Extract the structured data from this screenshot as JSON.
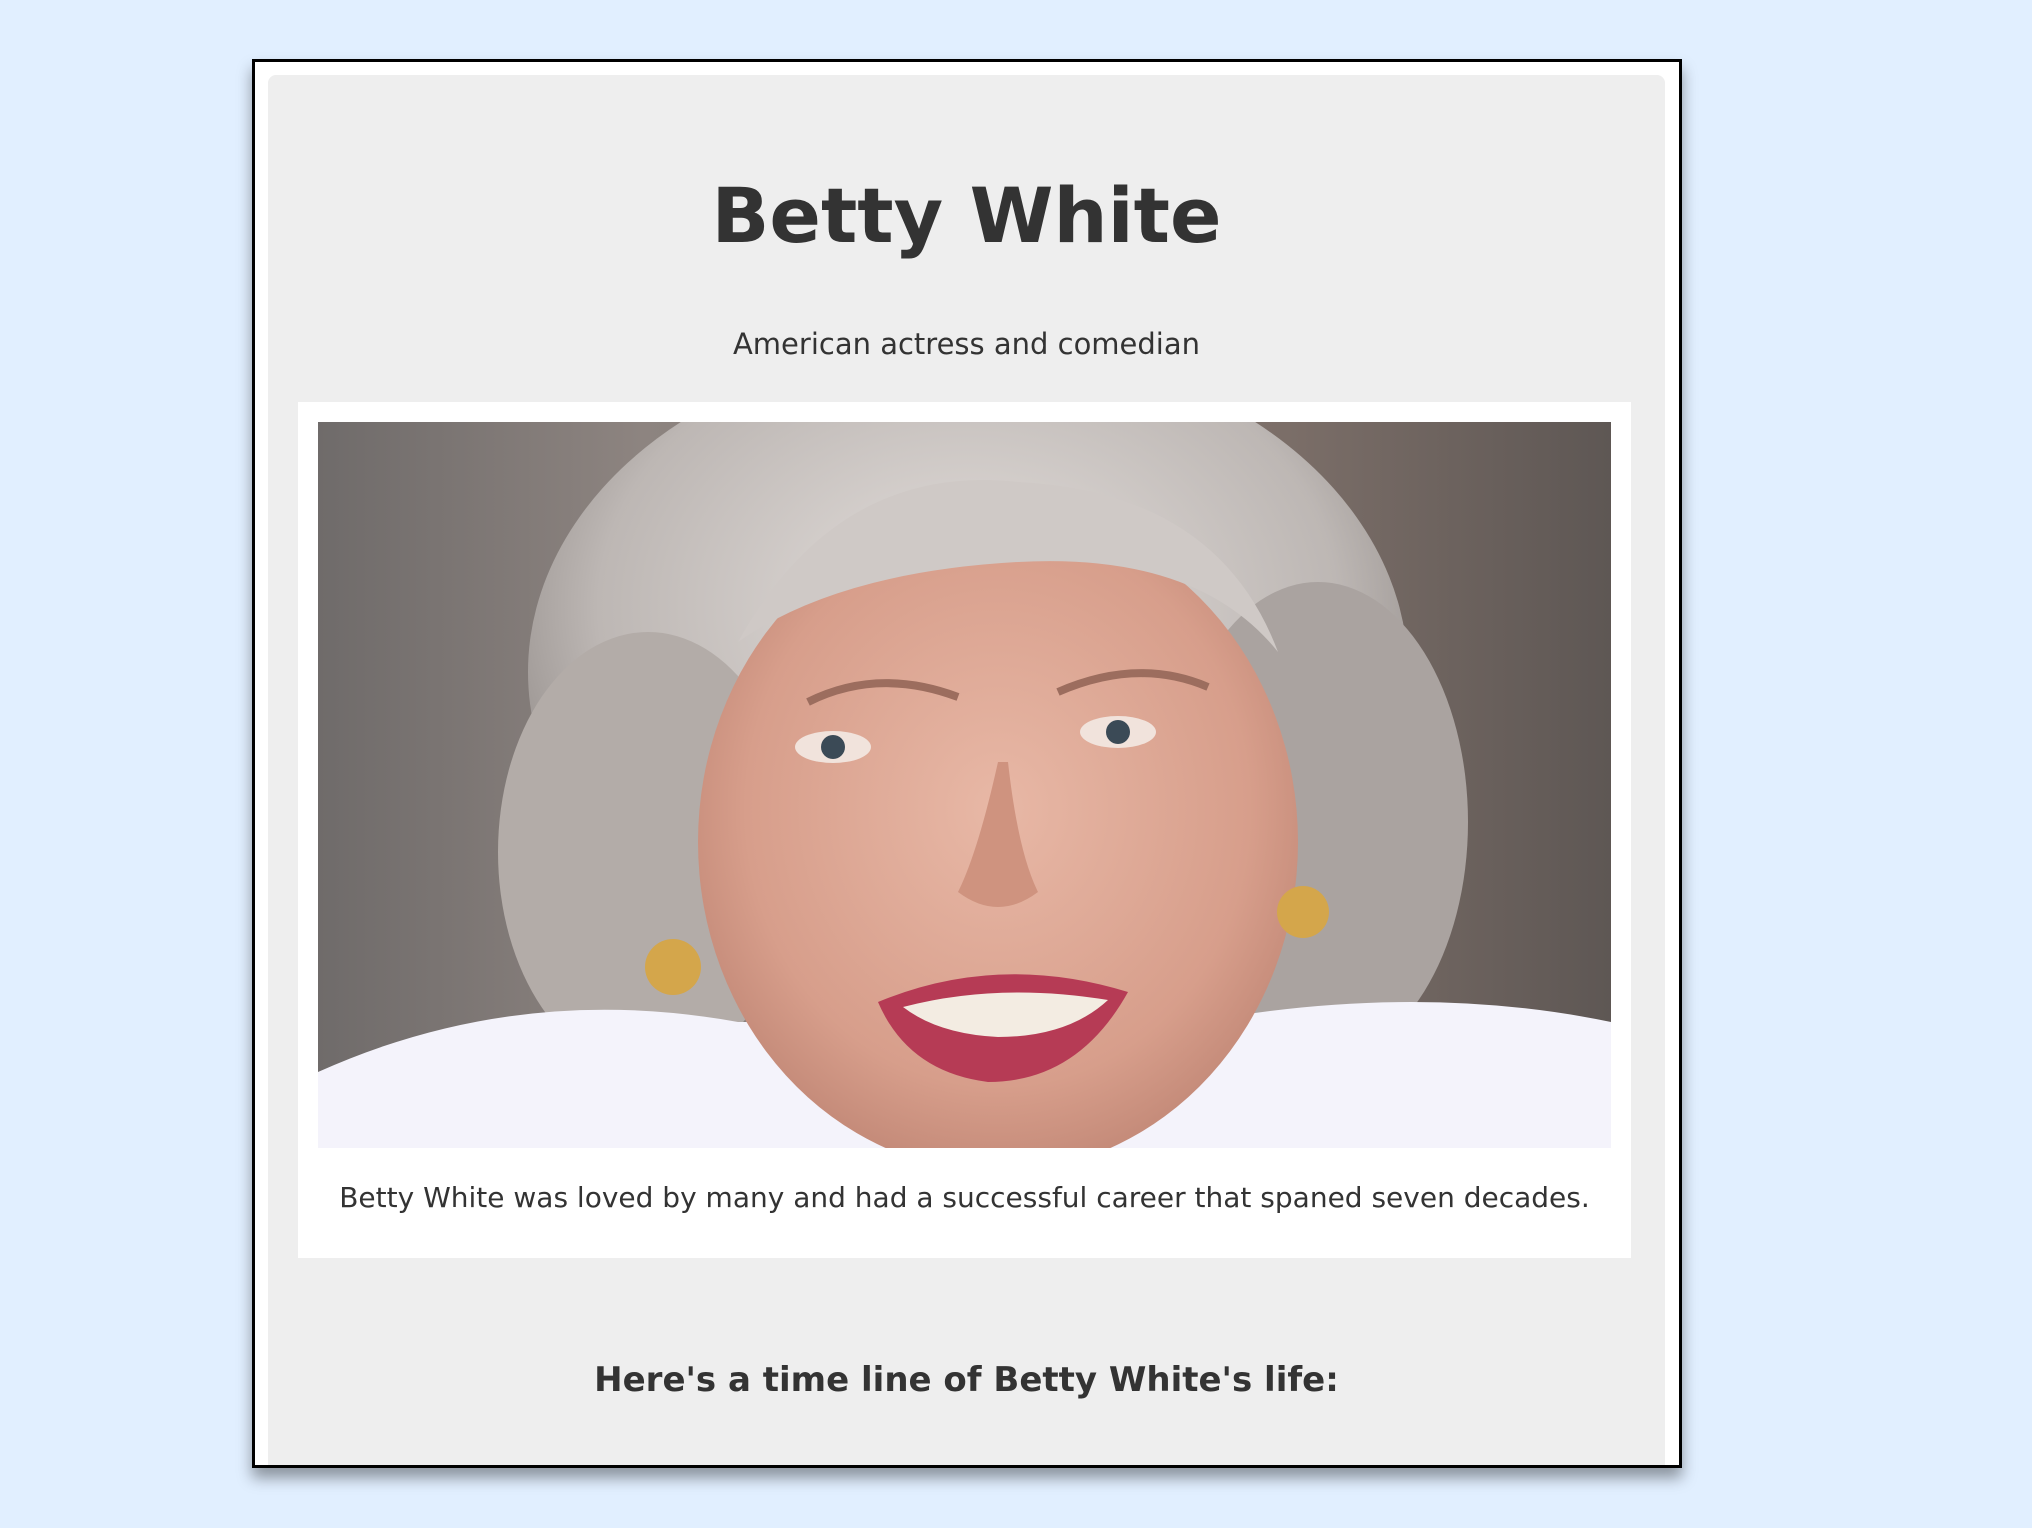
{
  "page": {
    "title": "Betty White",
    "subtitle": "American actress and comedian"
  },
  "image": {
    "caption": "Betty White was loved by many and had a successful career that spaned seven decades."
  },
  "timeline": {
    "heading": "Here's a time line of Betty White's life:"
  },
  "colors": {
    "page_background": "#e1efff",
    "card_background": "#eeeeee",
    "image_frame": "#ffffff",
    "text": "#333333",
    "border": "#000000"
  }
}
